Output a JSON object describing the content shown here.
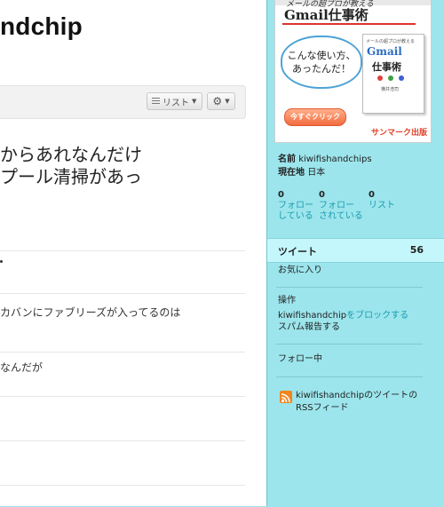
{
  "main": {
    "title": "ndchip",
    "toolbar": {
      "list_label": "リスト",
      "gear": "gear-icon"
    },
    "tweet": {
      "line1": "からあれなんだけ",
      "line2": "プール清掃があっ"
    },
    "rows": [
      {
        "text": ""
      },
      {
        "text": "カバンにファブリーズが入ってるのは"
      },
      {
        "text": "なんだが"
      },
      {
        "text": ""
      },
      {
        "text": ""
      },
      {
        "text": ""
      }
    ]
  },
  "ad": {
    "subtitle": "メールの超プロが教える",
    "title": "Gmail仕事術",
    "bubble_line1": "こんな使い方、",
    "bubble_line2": "あったんだ！",
    "book_subtitle": "メールの超プロが教える",
    "book_title": "Gmail",
    "book_title2": "仕事術",
    "book_author": "横井浩司",
    "button": "今すぐクリック",
    "publisher": "サンマーク出版",
    "colors": {
      "accent_red": "#dd3333",
      "book_blue": "#2b6bbf",
      "button": "#f26a3f"
    }
  },
  "profile": {
    "name_label": "名前",
    "name_value": "kiwifishandchips",
    "location_label": "現在地",
    "location_value": "日本",
    "stats": [
      {
        "num": "0",
        "lbl1": "フォロー",
        "lbl2": "している"
      },
      {
        "num": "0",
        "lbl1": "フォロー",
        "lbl2": "されている"
      },
      {
        "num": "0",
        "lbl1": "リスト",
        "lbl2": ""
      }
    ]
  },
  "sidebar": {
    "tweets_label": "ツイート",
    "tweets_count": "56",
    "favorites": "お気に入り",
    "actions_heading": "操作",
    "block_user": "kiwifishandchip",
    "block_suffix": "をブロックする",
    "report_spam": "スパム報告する",
    "following": "フォロー中",
    "rss_line1": "kiwifishandchipのツイートの",
    "rss_line2": "RSSフィード",
    "colors": {
      "background": "#9ce5ec",
      "link": "#1b9bb0",
      "tab": "#c4f7fb"
    }
  }
}
